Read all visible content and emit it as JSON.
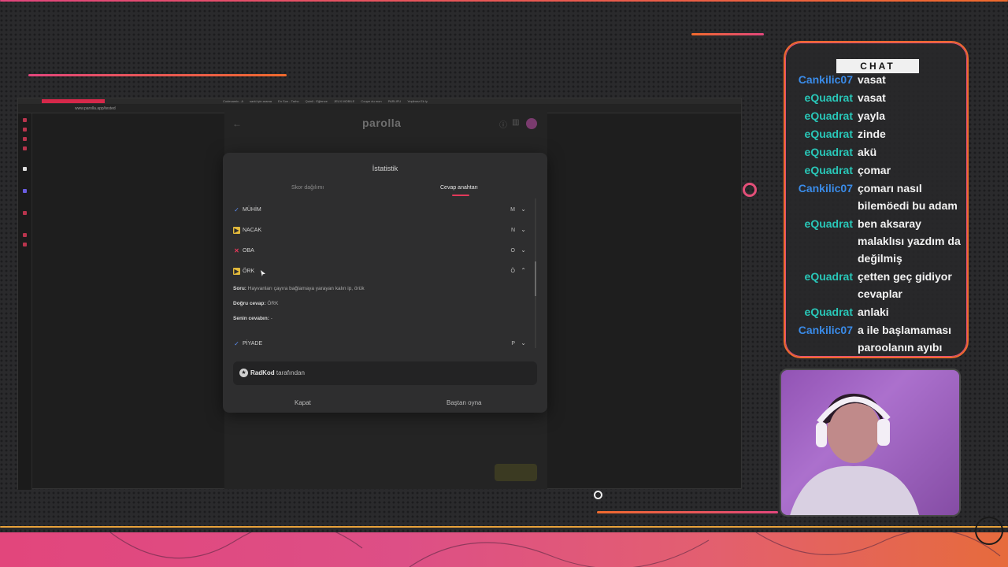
{
  "browser": {
    "url": "www.parolla.app/tested",
    "tabs": [
      "Codecamix - A",
      "sarki için arama",
      "En Son - Tarho",
      "Quinli - Eğlence",
      "JEUX MOBILE",
      "Coupe du mon",
      "PARLIFU",
      "Yeşilmez Ek ly"
    ]
  },
  "app": {
    "title": "parolla"
  },
  "modal": {
    "title": "İstatistik",
    "tabs": {
      "score": "Skor dağılımı",
      "answers": "Cevap anahtarı"
    },
    "rows": [
      {
        "status": "correct",
        "icon": "check-icon",
        "word": "MÜHİM",
        "letter": "M",
        "chevron": "⌄"
      },
      {
        "status": "passed",
        "icon": "pass-icon",
        "word": "NACAK",
        "letter": "N",
        "chevron": "⌄"
      },
      {
        "status": "wrong",
        "icon": "cross-icon",
        "word": "OBA",
        "letter": "O",
        "chevron": "⌄"
      },
      {
        "status": "passed",
        "icon": "pass-icon",
        "word": "ÖRK",
        "letter": "Ö",
        "chevron": "⌃"
      },
      {
        "status": "correct",
        "icon": "check-icon",
        "word": "PİYADE",
        "letter": "P",
        "chevron": "⌄"
      }
    ],
    "expanded": {
      "question_label": "Soru:",
      "question": "Hayvanları çayıra bağlamaya yarayan kalın ip, örük",
      "correct_label": "Doğru cevap:",
      "correct": "ÖRK",
      "yours_label": "Senin cevabın:",
      "yours": "-"
    },
    "credit": {
      "author": "RadKod",
      "suffix": "tarafından"
    },
    "buttons": {
      "close": "Kapat",
      "restart": "Baştan oyna"
    }
  },
  "chat": {
    "header": "CHAT",
    "messages": [
      {
        "user": "Cankilic07",
        "text": "vasat"
      },
      {
        "user": "eQuadrat",
        "text": "vasat"
      },
      {
        "user": "eQuadrat",
        "text": "yayla"
      },
      {
        "user": "eQuadrat",
        "text": "zinde"
      },
      {
        "user": "eQuadrat",
        "text": "akü"
      },
      {
        "user": "eQuadrat",
        "text": "çomar"
      },
      {
        "user": "Cankilic07",
        "text": "çomarı nasıl bilemöedi bu adam"
      },
      {
        "user": "eQuadrat",
        "text": "ben aksaray malaklısı yazdım da değilmiş"
      },
      {
        "user": "eQuadrat",
        "text": "çetten geç gidiyor cevaplar"
      },
      {
        "user": "eQuadrat",
        "text": "anlaki"
      },
      {
        "user": "Cankilic07",
        "text": "a ile başlamaması paroolanın ayıbı"
      }
    ]
  },
  "colors": {
    "accent_pink": "#e3395a",
    "accent_orange": "#f06a2d",
    "user_equadrat": "#29c7b8",
    "user_cankilic": "#3a8be8",
    "passed_yellow": "#e2b93b",
    "correct_blue": "#5b8df0"
  }
}
